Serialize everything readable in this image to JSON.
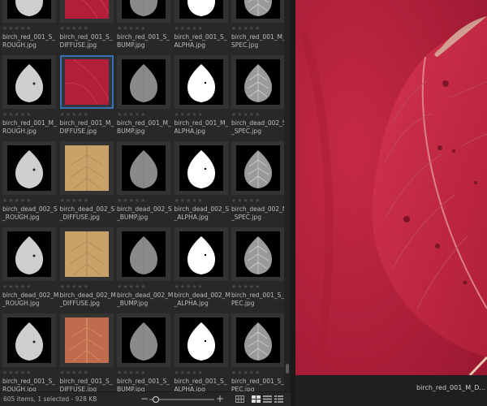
{
  "grid": {
    "items": [
      {
        "name": "birch_red_001_S_ROUGH.jpg",
        "kind": "gray-light",
        "stars": "★★★★★"
      },
      {
        "name": "birch_red_001_S_DIFFUSE.jpg",
        "kind": "red",
        "stars": "★★★★★"
      },
      {
        "name": "birch_red_001_S_BUMP.jpg",
        "kind": "gray",
        "stars": "★★★★★"
      },
      {
        "name": "birch_red_001_S_ALPHA.jpg",
        "kind": "white",
        "stars": "★★★★★"
      },
      {
        "name": "birch_red_001_M_SPEC.jpg",
        "kind": "spec",
        "stars": "★★★★★"
      },
      {
        "name": "birch_red_001_M_ROUGH.jpg",
        "kind": "gray-light",
        "stars": "★★★★★"
      },
      {
        "name": "birch_red_001_M_DIFFUSE.jpg",
        "kind": "red",
        "stars": "★★★★★"
      },
      {
        "name": "birch_red_001_M_BUMP.jpg",
        "kind": "gray",
        "stars": "★★★★★"
      },
      {
        "name": "birch_red_001_M_ALPHA.jpg",
        "kind": "white",
        "stars": "★★★★★"
      },
      {
        "name": "birch_dead_002_S_SPEC.jpg",
        "kind": "spec",
        "stars": "★★★★★"
      },
      {
        "name": "birch_dead_002_S_ROUGH.jpg",
        "kind": "gray-light",
        "stars": "★★★★★"
      },
      {
        "name": "birch_dead_002_S_DIFFUSE.jpg",
        "kind": "tan",
        "stars": "★★★★★"
      },
      {
        "name": "birch_dead_002_S_BUMP.jpg",
        "kind": "gray",
        "stars": "★★★★★"
      },
      {
        "name": "birch_dead_002_S_ALPHA.jpg",
        "kind": "white",
        "stars": "★★★★★"
      },
      {
        "name": "birch_dead_002_M_SPEC.jpg",
        "kind": "spec",
        "stars": "★★★★★"
      },
      {
        "name": "birch_dead_002_M_ROUGH.jpg",
        "kind": "gray-light",
        "stars": "★★★★★"
      },
      {
        "name": "birch_dead_002_M_DIFFUSE.jpg",
        "kind": "tan",
        "stars": "★★★★★"
      },
      {
        "name": "birch_dead_002_M_BUMP.jpg",
        "kind": "gray",
        "stars": "★★★★★"
      },
      {
        "name": "birch_dead_002_M_ALPHA.jpg",
        "kind": "white",
        "stars": "★★★★★"
      },
      {
        "name": "birch_red_001_S_SPEC.jpg",
        "kind": "spec",
        "stars": "★★★★★"
      },
      {
        "name": "birch_red_001_S_ROUGH.jpg",
        "kind": "gray-light",
        "stars": "★★★★★"
      },
      {
        "name": "birch_red_001_S_DIFFUSE.jpg",
        "kind": "orange",
        "stars": "★★★★★"
      },
      {
        "name": "birch_red_001_S_BUMP.jpg",
        "kind": "gray",
        "stars": "★★★★★"
      },
      {
        "name": "birch_red_001_S_ALPHA.jpg",
        "kind": "white",
        "stars": "★★★★★"
      },
      {
        "name": "birch_red_001_S_SPEC.jpg",
        "kind": "spec",
        "stars": "★★★★★"
      }
    ],
    "selected_index": 6
  },
  "preview": {
    "filename": "birch_red_001_M_D..."
  },
  "status": {
    "text": "605 items, 1 selected - 928 KB",
    "zoom_out_label": "−",
    "zoom_in_label": "+",
    "zoom_level": 0.1
  },
  "colors": {
    "selection": "#3a6fb0",
    "leaf_red": "#b81f3a",
    "panel_bg": "#282828"
  }
}
